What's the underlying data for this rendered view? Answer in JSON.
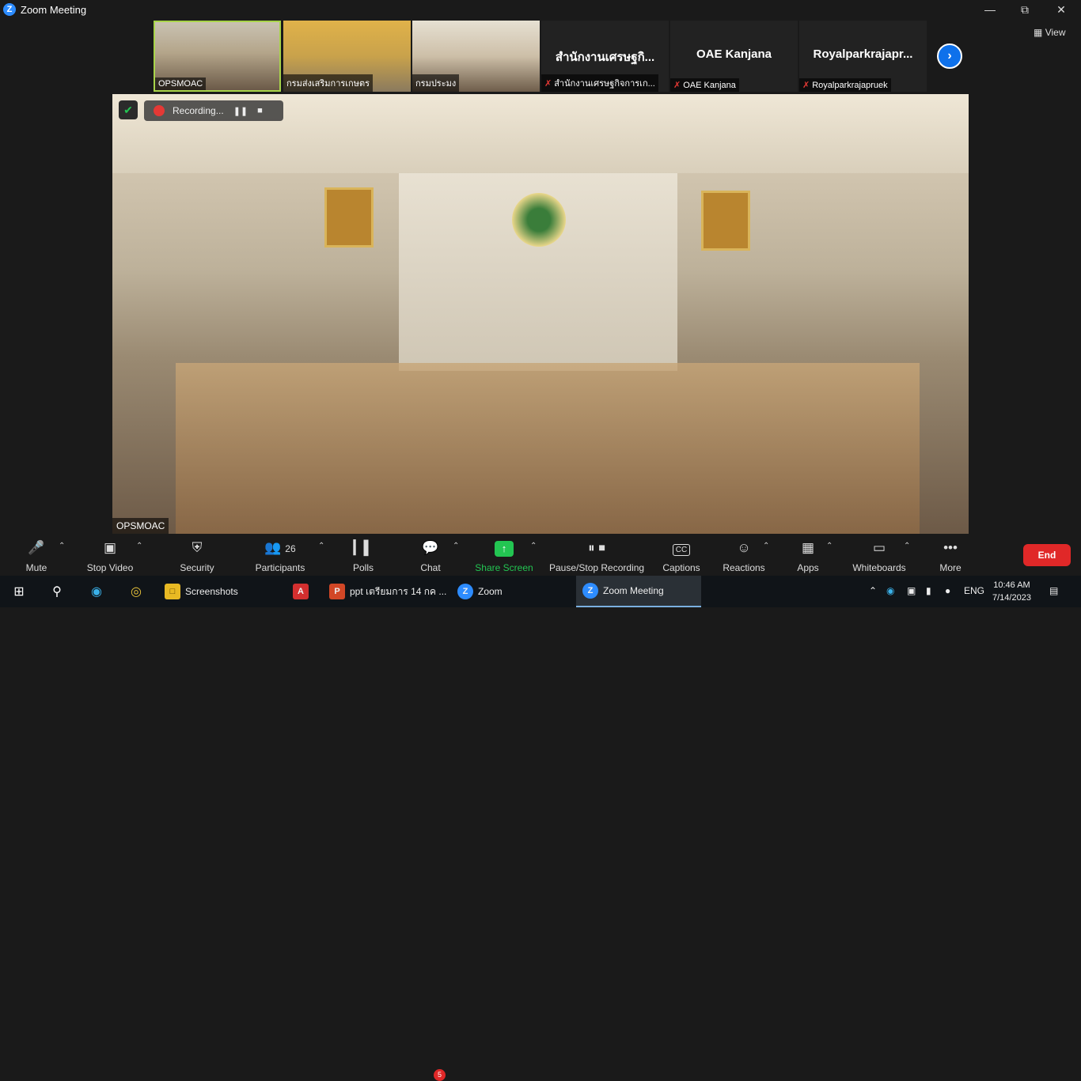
{
  "window": {
    "title": "Zoom Meeting",
    "icon": "zoom-logo-icon"
  },
  "strip": {
    "thumbnails": [
      {
        "label": "OPSMOAC",
        "kind": "video",
        "active": true
      },
      {
        "label": "กรมส่งเสริมการเกษตร",
        "kind": "video",
        "active": false
      },
      {
        "label": "กรมประมง",
        "kind": "video",
        "active": false
      },
      {
        "name": "สำนักงานเศรษฐกิ...",
        "label": "สำนักงานเศรษฐกิจการเก...",
        "kind": "name",
        "muted": true
      },
      {
        "name": "OAE Kanjana",
        "label": "OAE Kanjana",
        "kind": "name",
        "muted": true
      },
      {
        "name": "Royalparkrajapr...",
        "label": "Royalparkrajapruek",
        "kind": "name",
        "muted": true
      }
    ],
    "view_label": "View"
  },
  "main": {
    "recording_label": "Recording...",
    "speaker_label": "OPSMOAC"
  },
  "toolbar": {
    "mute": "Mute",
    "stop_video": "Stop Video",
    "security": "Security",
    "participants": "Participants",
    "participants_count": "26",
    "polls": "Polls",
    "chat": "Chat",
    "chat_badge": "5",
    "share_screen": "Share Screen",
    "pause_stop_recording": "Pause/Stop Recording",
    "captions": "Captions",
    "captions_icon_text": "CC",
    "reactions": "Reactions",
    "apps": "Apps",
    "whiteboards": "Whiteboards",
    "more": "More",
    "end": "End",
    "accent": "#23c552",
    "end_color": "#e02828"
  },
  "taskbar": {
    "apps": [
      {
        "label": "Screenshots",
        "icon": "folder-icon"
      },
      {
        "label": "",
        "icon": "pdf-icon"
      },
      {
        "label": "ppt เตรียมการ 14 กค ...",
        "icon": "powerpoint-icon"
      },
      {
        "label": "Zoom",
        "icon": "zoom-icon"
      },
      {
        "label": "Zoom Meeting",
        "icon": "zoom-icon"
      }
    ],
    "lang": "ENG",
    "time": "10:46 AM",
    "date": "7/14/2023"
  }
}
